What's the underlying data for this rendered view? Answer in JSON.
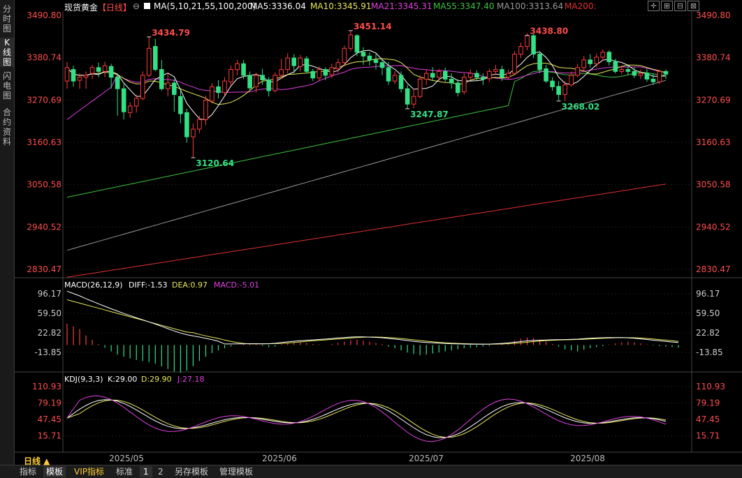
{
  "rail": [
    {
      "label": "分时图"
    },
    {
      "label": "K线图"
    },
    {
      "label": "闪电图"
    },
    {
      "label": "合约资料"
    }
  ],
  "header": {
    "title": "现货黄金",
    "period": "【日线】",
    "ma_label": "MA(5,10,21,55,100,200)",
    "ma5": "MA5:3336.04",
    "ma10": "MA10:3345.91",
    "ma21": "MA21:3345.31",
    "ma55": "MA55:3347.40",
    "ma100": "MA100:3313.64",
    "ma200": "MA200:"
  },
  "colors": {
    "up": "#ff3b3b",
    "down": "#33e085",
    "ma5": "#ffffff",
    "ma10": "#e8e85a",
    "ma21": "#e040e0",
    "ma55": "#3ec23e",
    "ma100": "#9a9a9a",
    "ma200": "#e03030",
    "dea": "#e8e85a",
    "macd": "#e040e0",
    "kdj_j": "#e040e0",
    "text_price": "#ff4d4d",
    "text_low": "#33e085"
  },
  "macd_header": {
    "label": "MACD(26,12,9)",
    "diff": "DIFF:-1.53",
    "dea": "DEA:0.97",
    "macd": "MACD:-5.01"
  },
  "kdj_header": {
    "label": "KDJ(9,3,3)",
    "k": "K:29.00",
    "d": "D:29.90",
    "j": "J:27.18"
  },
  "bottom_bar": {
    "period": "日线 ▲",
    "tabs": [
      "指标",
      "模板",
      "VIP指标",
      "标准",
      "1",
      "2",
      "另存模板",
      "管理模板"
    ]
  },
  "chart_data": [
    {
      "type": "candlestick",
      "title": "现货黄金【日线】",
      "x_labels": [
        "2025/05",
        "2025/06",
        "2025/07",
        "2025/08"
      ],
      "y_ticks": [
        3490.8,
        3380.74,
        3270.69,
        3160.63,
        3050.58,
        2940.52,
        2830.47
      ],
      "ylim": [
        2805,
        3490.8
      ],
      "annotations": [
        {
          "text": "3434.79",
          "type": "high"
        },
        {
          "text": "3451.14",
          "type": "high"
        },
        {
          "text": "3438.80",
          "type": "high"
        },
        {
          "text": "3120.64",
          "type": "low"
        },
        {
          "text": "3247.87",
          "type": "low"
        },
        {
          "text": "3268.02",
          "type": "low"
        }
      ],
      "candles": [
        [
          3320,
          3355,
          3300,
          3370
        ],
        [
          3350,
          3320,
          3305,
          3360
        ],
        [
          3322,
          3330,
          3300,
          3340
        ],
        [
          3330,
          3335,
          3300,
          3345
        ],
        [
          3340,
          3355,
          3325,
          3362
        ],
        [
          3355,
          3345,
          3330,
          3368
        ],
        [
          3345,
          3360,
          3330,
          3370
        ],
        [
          3358,
          3330,
          3300,
          3365
        ],
        [
          3330,
          3300,
          3230,
          3338
        ],
        [
          3300,
          3240,
          3220,
          3312
        ],
        [
          3238,
          3255,
          3225,
          3265
        ],
        [
          3255,
          3275,
          3238,
          3285
        ],
        [
          3275,
          3335,
          3270,
          3345
        ],
        [
          3335,
          3405,
          3330,
          3435
        ],
        [
          3410,
          3350,
          3345,
          3430
        ],
        [
          3350,
          3300,
          3295,
          3375
        ],
        [
          3300,
          3315,
          3280,
          3342
        ],
        [
          3315,
          3285,
          3240,
          3325
        ],
        [
          3280,
          3235,
          3210,
          3295
        ],
        [
          3238,
          3175,
          3160,
          3248
        ],
        [
          3175,
          3195,
          3121,
          3210
        ],
        [
          3195,
          3220,
          3185,
          3230
        ],
        [
          3220,
          3270,
          3205,
          3282
        ],
        [
          3268,
          3305,
          3262,
          3315
        ],
        [
          3305,
          3290,
          3275,
          3322
        ],
        [
          3290,
          3320,
          3282,
          3330
        ],
        [
          3318,
          3350,
          3308,
          3360
        ],
        [
          3350,
          3365,
          3335,
          3375
        ],
        [
          3365,
          3335,
          3325,
          3375
        ],
        [
          3335,
          3302,
          3295,
          3345
        ],
        [
          3305,
          3335,
          3290,
          3342
        ],
        [
          3335,
          3323,
          3310,
          3352
        ],
        [
          3323,
          3295,
          3280,
          3330
        ],
        [
          3295,
          3335,
          3290,
          3342
        ],
        [
          3335,
          3350,
          3325,
          3378
        ],
        [
          3350,
          3380,
          3340,
          3392
        ],
        [
          3380,
          3360,
          3340,
          3390
        ],
        [
          3358,
          3380,
          3345,
          3388
        ],
        [
          3378,
          3345,
          3340,
          3385
        ],
        [
          3345,
          3328,
          3320,
          3352
        ],
        [
          3328,
          3350,
          3320,
          3358
        ],
        [
          3350,
          3335,
          3322,
          3356
        ],
        [
          3336,
          3355,
          3328,
          3365
        ],
        [
          3352,
          3368,
          3342,
          3378
        ],
        [
          3368,
          3405,
          3360,
          3412
        ],
        [
          3405,
          3440,
          3398,
          3451
        ],
        [
          3438,
          3395,
          3385,
          3442
        ],
        [
          3395,
          3385,
          3362,
          3408
        ],
        [
          3385,
          3375,
          3360,
          3395
        ],
        [
          3375,
          3368,
          3350,
          3390
        ],
        [
          3368,
          3355,
          3335,
          3375
        ],
        [
          3355,
          3320,
          3310,
          3370
        ],
        [
          3320,
          3335,
          3312,
          3345
        ],
        [
          3335,
          3300,
          3290,
          3345
        ],
        [
          3300,
          3260,
          3248,
          3310
        ],
        [
          3260,
          3280,
          3250,
          3300
        ],
        [
          3280,
          3325,
          3275,
          3335
        ],
        [
          3325,
          3340,
          3310,
          3350
        ],
        [
          3340,
          3330,
          3320,
          3356
        ],
        [
          3330,
          3345,
          3320,
          3352
        ],
        [
          3345,
          3325,
          3318,
          3355
        ],
        [
          3325,
          3315,
          3300,
          3340
        ],
        [
          3315,
          3290,
          3280,
          3325
        ],
        [
          3292,
          3330,
          3285,
          3340
        ],
        [
          3330,
          3340,
          3322,
          3350
        ],
        [
          3340,
          3330,
          3322,
          3348
        ],
        [
          3330,
          3325,
          3310,
          3340
        ],
        [
          3326,
          3345,
          3318,
          3352
        ],
        [
          3345,
          3350,
          3335,
          3362
        ],
        [
          3350,
          3330,
          3320,
          3360
        ],
        [
          3330,
          3340,
          3325,
          3350
        ],
        [
          3340,
          3390,
          3335,
          3398
        ],
        [
          3390,
          3410,
          3380,
          3420
        ],
        [
          3410,
          3438,
          3400,
          3444
        ],
        [
          3438,
          3390,
          3380,
          3442
        ],
        [
          3390,
          3350,
          3340,
          3398
        ],
        [
          3352,
          3320,
          3315,
          3362
        ],
        [
          3320,
          3305,
          3295,
          3330
        ],
        [
          3306,
          3285,
          3270,
          3320
        ],
        [
          3285,
          3310,
          3268,
          3320
        ],
        [
          3310,
          3335,
          3305,
          3345
        ],
        [
          3335,
          3355,
          3330,
          3365
        ],
        [
          3355,
          3375,
          3345,
          3385
        ],
        [
          3375,
          3365,
          3355,
          3390
        ],
        [
          3365,
          3382,
          3355,
          3392
        ],
        [
          3382,
          3395,
          3372,
          3402
        ],
        [
          3395,
          3370,
          3360,
          3400
        ],
        [
          3370,
          3345,
          3340,
          3378
        ],
        [
          3345,
          3350,
          3338,
          3360
        ],
        [
          3350,
          3345,
          3335,
          3360
        ],
        [
          3345,
          3335,
          3328,
          3356
        ],
        [
          3335,
          3340,
          3325,
          3350
        ],
        [
          3340,
          3325,
          3318,
          3352
        ],
        [
          3325,
          3318,
          3310,
          3340
        ],
        [
          3318,
          3345,
          3312,
          3348
        ],
        [
          3345,
          3338,
          3325,
          3350
        ]
      ]
    },
    {
      "type": "bar",
      "title": "MACD(26,12,9)",
      "y_ticks": [
        96.17,
        59.5,
        22.82,
        -13.85
      ],
      "ylim": [
        -50,
        100
      ],
      "values": [
        40,
        35,
        30,
        18,
        10,
        2,
        -5,
        -12,
        -18,
        -22,
        -25,
        -28,
        -30,
        -32,
        -35,
        -40,
        -45,
        -50,
        -52,
        -48,
        -40,
        -30,
        -22,
        -15,
        -10,
        -6,
        -3,
        0,
        2,
        3,
        2,
        -2,
        -4,
        -3,
        1,
        4,
        5,
        6,
        4,
        2,
        1,
        0,
        2,
        4,
        6,
        9,
        10,
        8,
        6,
        4,
        2,
        -3,
        -6,
        -10,
        -14,
        -17,
        -19,
        -18,
        -16,
        -14,
        -12,
        -10,
        -8,
        -6,
        -5,
        -4,
        -3,
        -2,
        0,
        2,
        4,
        8,
        12,
        14,
        13,
        10,
        6,
        2,
        -3,
        -8,
        -10,
        -12,
        -9,
        -6,
        -4,
        -2,
        1,
        3,
        5,
        6,
        5,
        3,
        1,
        -1,
        -2,
        -3,
        -4,
        -5
      ]
    },
    {
      "type": "line",
      "title": "KDJ(9,3,3)",
      "y_ticks": [
        110.93,
        79.19,
        47.45,
        15.71
      ],
      "ylim": [
        -5,
        115
      ]
    }
  ]
}
